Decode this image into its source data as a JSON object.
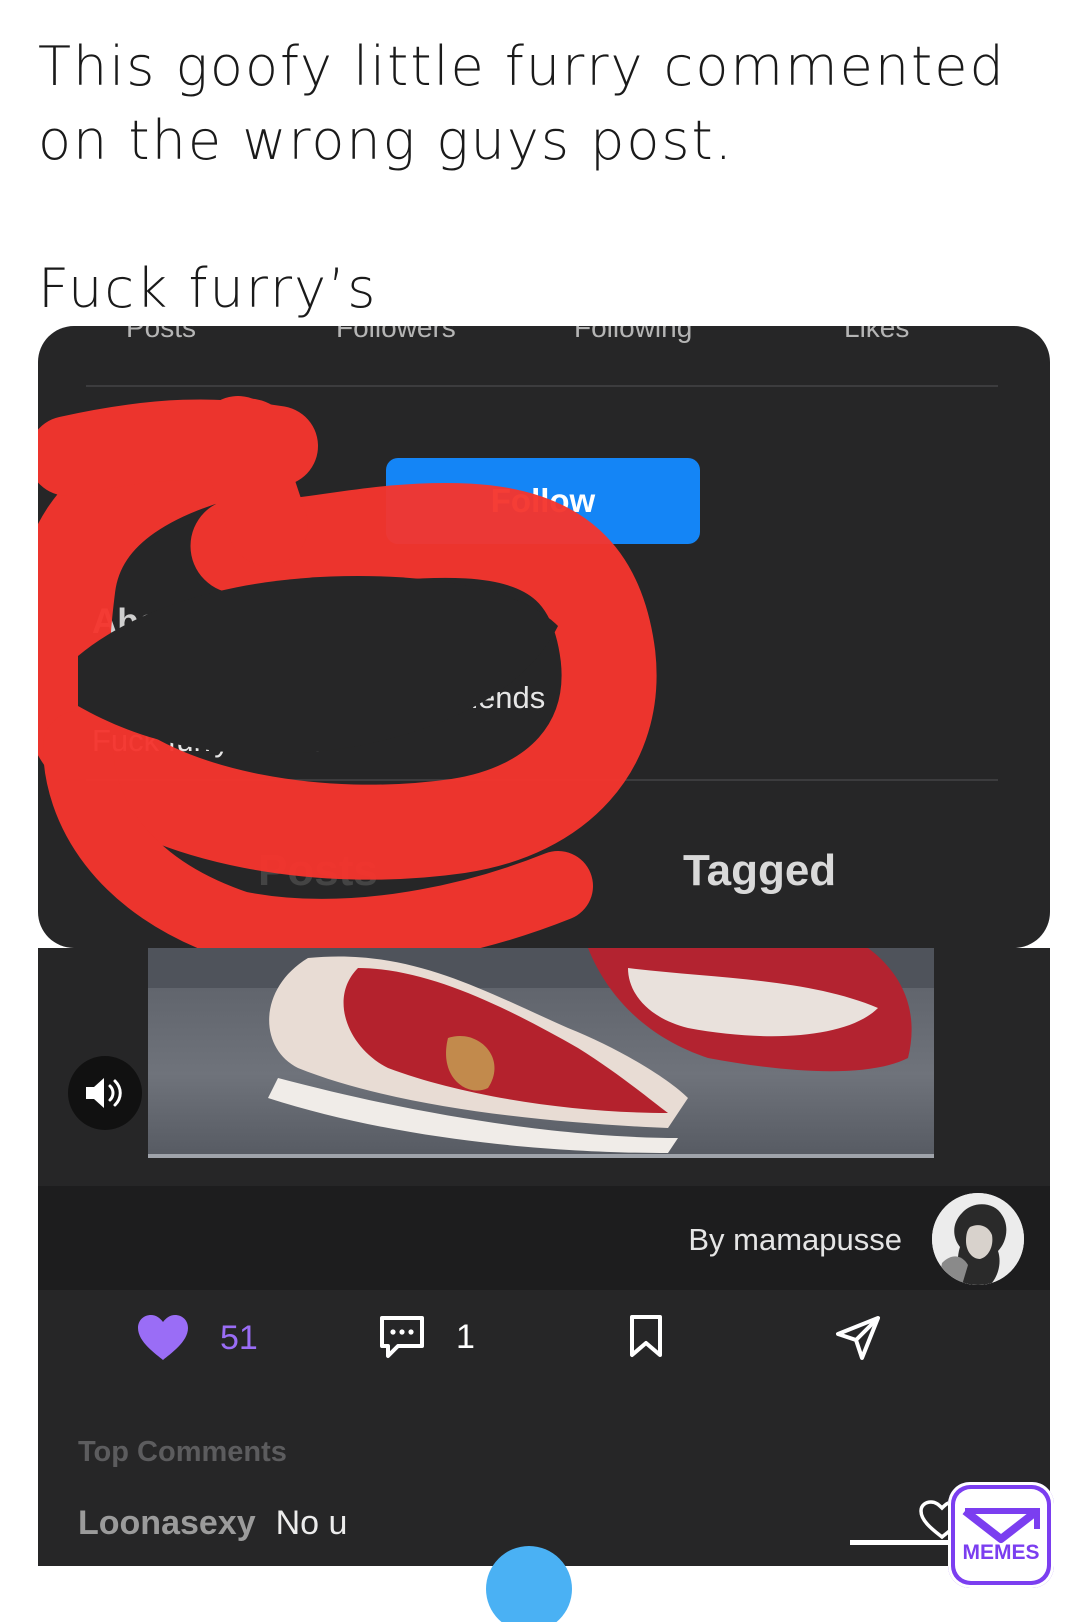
{
  "caption": {
    "line1": "This goofy little furry commented",
    "line2": "on the wrong guys post.",
    "line3": "Fuck furry’s"
  },
  "profile": {
    "stats": [
      "Posts",
      "Followers",
      "Following",
      "Likes"
    ],
    "follow_label": "Follow",
    "about_title": "About Me",
    "about_line1": "I’m Loona and hope to be friends",
    "about_line2": "Fuck furry haters",
    "tabs": [
      "Posts",
      "Tagged"
    ]
  },
  "post": {
    "byline": "By mamapusse",
    "likes": "51",
    "comments": "1",
    "top_comments_label": "Top Comments",
    "comment_author": "Loonasexy",
    "comment_text": "No u"
  },
  "colors": {
    "follow_blue": "#1485f6",
    "like_purple": "#9a6df6",
    "scribble_red": "#f5352e",
    "card_bg": "#262627"
  },
  "icons": [
    "speaker-icon",
    "heart-icon",
    "comment-icon",
    "bookmark-icon",
    "share-icon",
    "comment-heart-icon",
    "memes-logo"
  ],
  "watermark": {
    "label": "MEMES"
  }
}
